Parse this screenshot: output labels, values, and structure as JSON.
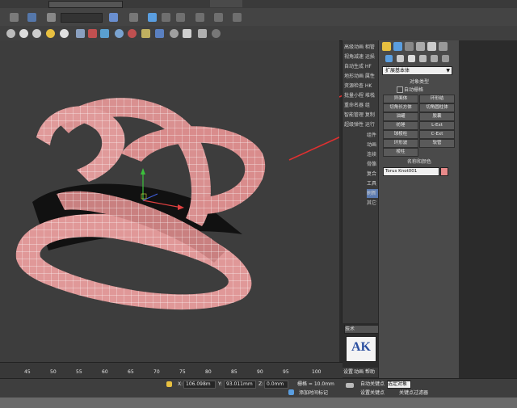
{
  "side_panel": {
    "items": [
      "高级动画 相管",
      "视角减速 运损",
      "自动生成 HF",
      "地形动画 属性",
      "资源检查 HK",
      "批量小程 堆栈",
      "重命名器 组",
      "智能管理 复制",
      "超级弹性 运行",
      "组件",
      "动画",
      "连续",
      "骨骼",
      "复合",
      "工具",
      "刷新",
      "其它"
    ],
    "dropdown_value": "技术"
  },
  "command_panel": {
    "category_dropdown": "扩展基本体",
    "object_type_header": "对象类型",
    "autogrid_label": "自动栅格",
    "buttons": [
      [
        "异面体",
        "环形结"
      ],
      [
        "切角长方体",
        "切角圆柱体"
      ],
      [
        "油罐",
        "胶囊"
      ],
      [
        "纺锤",
        "L-Ext"
      ],
      [
        "球棱柱",
        "C-Ext"
      ],
      [
        "环形波",
        "软管"
      ],
      [
        "棱柱",
        ""
      ]
    ],
    "name_color_header": "名称和颜色",
    "object_name": "Torus Knot001",
    "object_color": "#e88a8a"
  },
  "logo": {
    "text": "AK"
  },
  "timeline": {
    "ticks": [
      "45",
      "50",
      "55",
      "60",
      "65",
      "70",
      "75",
      "80",
      "85",
      "90",
      "95",
      "100"
    ]
  },
  "status": {
    "x_label": "X:",
    "x_value": "106.098m",
    "y_label": "Y:",
    "y_value": "93.011mm",
    "z_label": "Z:",
    "z_value": "0.0mm",
    "grid_text": "栅格 = 10.0mm",
    "add_time_tag": "添加时间标记",
    "auto_key": "自动关键点",
    "selected": "选定对象",
    "set_key": "设置关键点",
    "key_filter": "关键点过滤器",
    "side_btns": [
      "设置",
      "动画",
      "帮助"
    ]
  },
  "colors": {
    "torus": "#d99090",
    "arrow": "#e03030"
  }
}
